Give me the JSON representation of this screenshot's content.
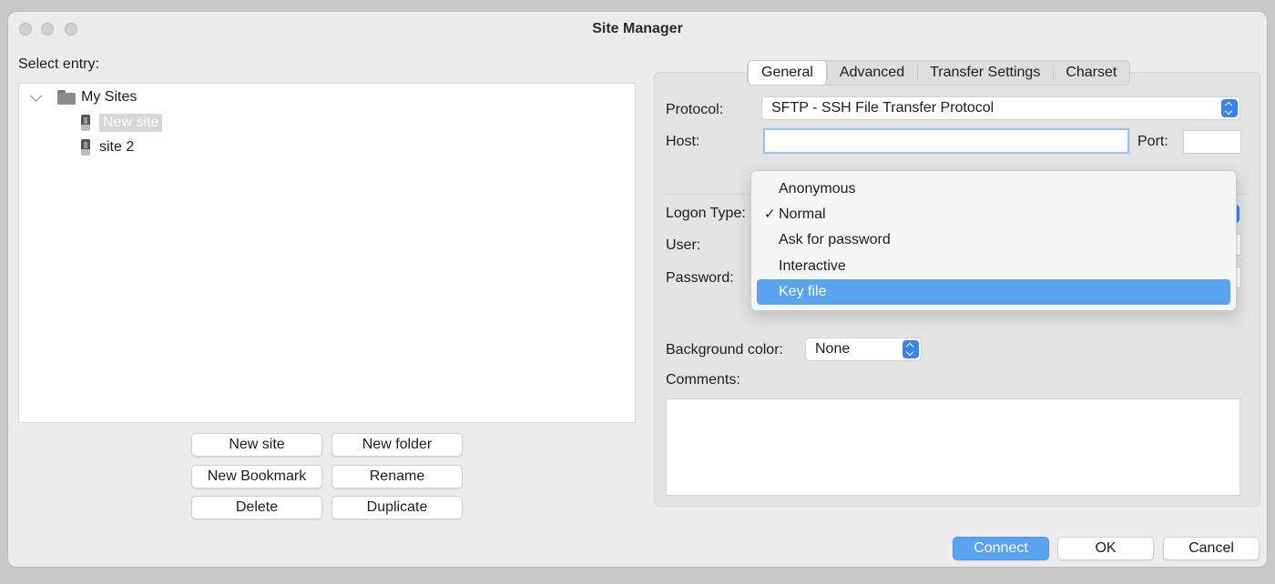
{
  "window": {
    "title": "Site Manager"
  },
  "left": {
    "select_entry_label": "Select entry:",
    "tree": {
      "root": "My Sites",
      "items": [
        "New site",
        "site 2"
      ]
    },
    "buttons": {
      "new_site": "New site",
      "new_folder": "New folder",
      "new_bookmark": "New Bookmark",
      "rename": "Rename",
      "delete": "Delete",
      "duplicate": "Duplicate"
    }
  },
  "tabs": [
    "General",
    "Advanced",
    "Transfer Settings",
    "Charset"
  ],
  "general": {
    "protocol_label": "Protocol:",
    "protocol_value": "SFTP - SSH File Transfer Protocol",
    "host_label": "Host:",
    "host_value": "",
    "port_label": "Port:",
    "port_value": "",
    "logon_type_label": "Logon Type:",
    "user_label": "User:",
    "password_label": "Password:",
    "background_color_label": "Background color:",
    "background_color_value": "None",
    "comments_label": "Comments:"
  },
  "logon_dropdown": {
    "options": [
      "Anonymous",
      "Normal",
      "Ask for password",
      "Interactive",
      "Key file"
    ],
    "checked": "Normal",
    "highlighted": "Key file",
    "check_glyph": "✓"
  },
  "footer": {
    "connect": "Connect",
    "ok": "OK",
    "cancel": "Cancel"
  },
  "colors": {
    "accent": "#5aa3f0",
    "stepper": "#3b82f6"
  }
}
